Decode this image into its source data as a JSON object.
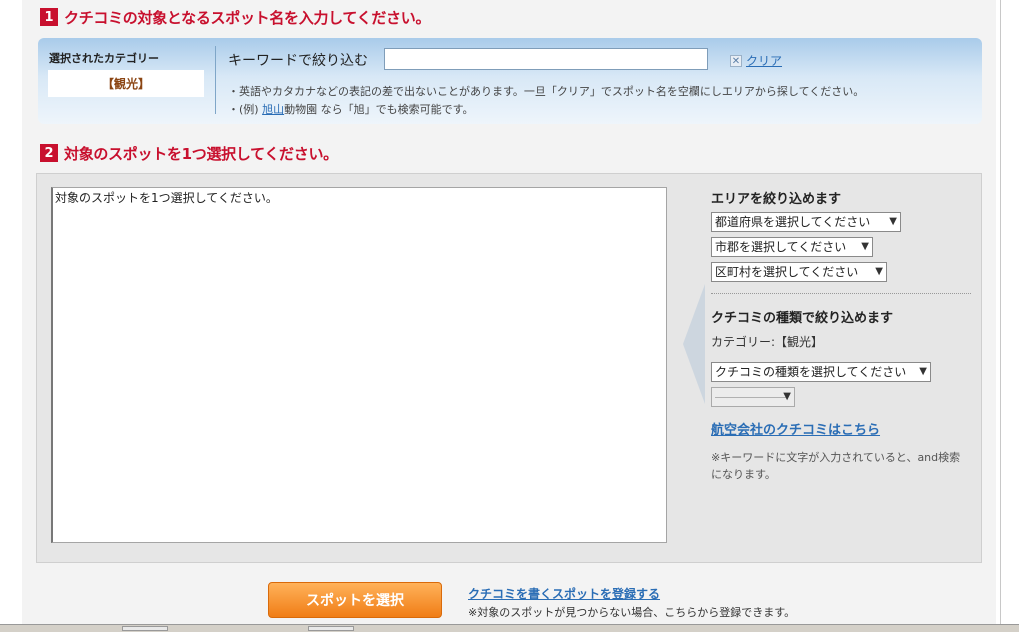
{
  "step1": {
    "number": "1",
    "title": "クチコミの対象となるスポット名を入力してください。",
    "selected_category_label": "選択されたカテゴリー",
    "selected_category_value": "【観光】",
    "keyword_label": "キーワードで絞り込む",
    "keyword_value": "",
    "clear_icon": "close-icon",
    "clear_label": "クリア",
    "note1": "・英語やカタカナなどの表記の差で出ないことがあります。一旦「クリア」でスポット名を空欄にしエリアから探してください。",
    "note2_prefix": "・(例)",
    "note2_link": "旭山",
    "note2_mid": "動物園",
    "note2_suffix": "なら「旭」でも検索可能です。"
  },
  "step2": {
    "number": "2",
    "title": "対象のスポットを1つ選択してください。",
    "result_placeholder": "対象のスポットを1つ選択してください。"
  },
  "area_filter": {
    "title": "エリアを絞り込めます",
    "prefecture_select": "都道府県を選択してください",
    "city_select": "市郡を選択してください",
    "ward_select": "区町村を選択してください"
  },
  "type_filter": {
    "title": "クチコミの種類で絞り込めます",
    "category_text": "カテゴリー:【観光】",
    "type_select": "クチコミの種類を選択してください",
    "sub_select": "――――――",
    "airline_link": "航空会社のクチコミはこちら",
    "keyword_note": "※キーワードに文字が入力されていると、and検索になります。"
  },
  "footer": {
    "select_button": "スポットを選択",
    "register_link": "クチコミを書くスポットを登録する",
    "register_note": "※対象のスポットが見つからない場合、こちらから登録できます。"
  },
  "colors": {
    "accent_red": "#c8102e",
    "link_blue": "#2a6db5",
    "button_orange": "#f07d16",
    "panel_blue": "#a9cbea"
  }
}
